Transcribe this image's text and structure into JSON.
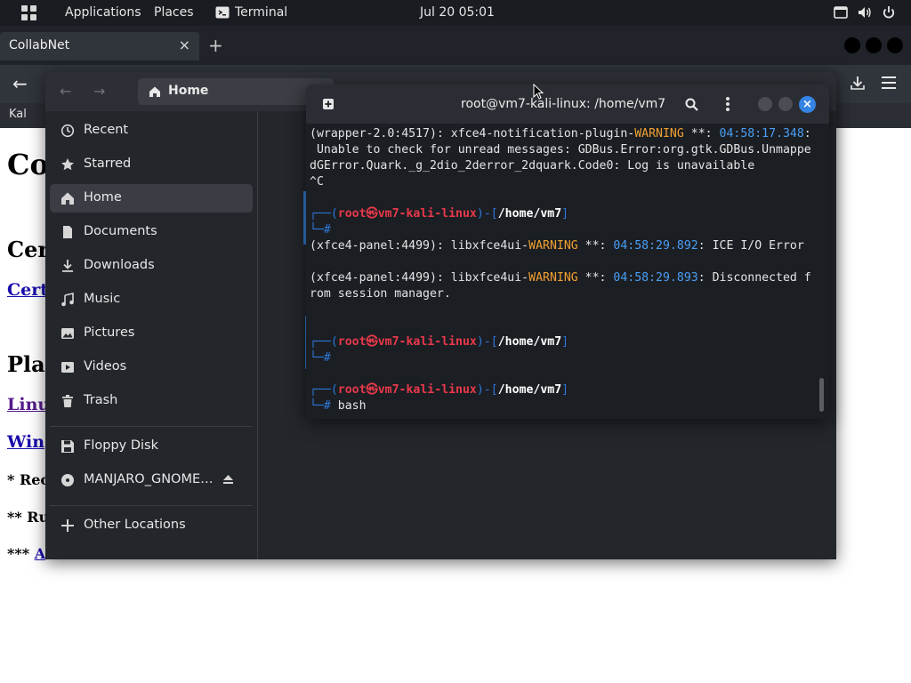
{
  "topbar": {
    "applications": "Applications",
    "places": "Places",
    "terminal_app": "Terminal",
    "clock": "Jul 20  05:01"
  },
  "browser": {
    "tab_title": "CollabNet",
    "close_glyph": "×",
    "newtab_glyph": "+",
    "back_glyph": "←",
    "bookmark": "Kal"
  },
  "page": {
    "h1": "Co",
    "h2a": "Cer",
    "link1": "Cert",
    "h2b": "Pla",
    "link2": "Linu",
    "link3": "Win",
    "item1": "* Rec",
    "item2": "** Ru",
    "item3_prefix": "***",
    "item3_link": "A"
  },
  "files": {
    "back_glyph": "←",
    "forward_glyph": "→",
    "path": "Home",
    "sidebar": [
      {
        "label": "Recent",
        "icon": "clock-icon"
      },
      {
        "label": "Starred",
        "icon": "star-icon"
      },
      {
        "label": "Home",
        "icon": "home-icon",
        "active": true
      },
      {
        "label": "Documents",
        "icon": "document-icon"
      },
      {
        "label": "Downloads",
        "icon": "download-icon"
      },
      {
        "label": "Music",
        "icon": "music-icon"
      },
      {
        "label": "Pictures",
        "icon": "picture-icon"
      },
      {
        "label": "Videos",
        "icon": "video-icon"
      },
      {
        "label": "Trash",
        "icon": "trash-icon"
      },
      {
        "label": "Floppy Disk",
        "icon": "floppy-icon"
      },
      {
        "label": "MANJARO_GNOME…",
        "icon": "disc-icon"
      },
      {
        "label": "Other Locations",
        "icon": "plus-icon"
      }
    ]
  },
  "terminal": {
    "title": "root@vm7-kali-linux: /home/vm7",
    "close_glyph": "×",
    "lines": {
      "l1a": "(wrapper-2.0:4517): xfce4-notification-plugin-",
      "l1w": "WARNING",
      "l1b": " **: ",
      "l1t": "04:58:17.348",
      "l1c": ":",
      "l2": " Unable to check for unread messages: GDBus.Error:org.gtk.GDBus.Unmappe",
      "l3": "dGError.Quark._g_2dio_2derror_2dquark.Code0: Log is unavailable",
      "l4": "^C",
      "prompt_open": "┌──(",
      "prompt_user": "root㉿vm7-kali-linux",
      "prompt_mid": ")-[",
      "prompt_path": "/home/vm7",
      "prompt_close": "]",
      "prompt_hash": "└─#",
      "l6a": "(xfce4-panel:4499): libxfce4ui-",
      "l6w": "WARNING",
      "l6b": " **: ",
      "l6t": "04:58:29.892",
      "l6c": ": ICE I/O Error",
      "l7a": "(xfce4-panel:4499): libxfce4ui-",
      "l7w": "WARNING",
      "l7b": " **: ",
      "l7t": "04:58:29.893",
      "l7c": ": Disconnected f",
      "l8": "rom session manager.",
      "cmd": "bash"
    }
  },
  "colors": {
    "accent": "#3584e4",
    "warning": "#f0a030",
    "timestamp": "#4a9ff5",
    "prompt_user": "#e8394a"
  }
}
